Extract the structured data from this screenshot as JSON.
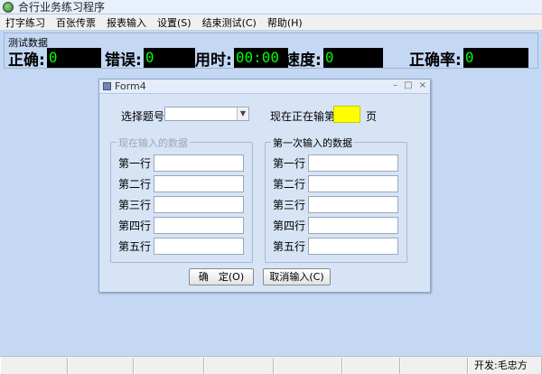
{
  "window": {
    "title": "合行业务练习程序"
  },
  "menu": [
    {
      "label": "打字练习"
    },
    {
      "label": "百张传票"
    },
    {
      "label": "报表输入"
    },
    {
      "label": "设置(S)"
    },
    {
      "label": "结束测试(C)"
    },
    {
      "label": "帮助(H)"
    }
  ],
  "stats": {
    "section_label": "测试数据",
    "correct": {
      "label": "正确:",
      "value": "0"
    },
    "errors": {
      "label": "错误:",
      "value": "0"
    },
    "time": {
      "label": "用时:",
      "value": "00:00"
    },
    "speed": {
      "label": "速度:",
      "value": "0"
    },
    "accuracy": {
      "label": "正确率:",
      "value": "0"
    }
  },
  "form4": {
    "title": "Form4",
    "select_label": "选择题号",
    "select_value": "",
    "current_label": "现在正在输第",
    "current_page": "",
    "page_unit": "页",
    "left_group": {
      "title": "现在输入的数据",
      "rows": [
        {
          "label": "第一行",
          "value": ""
        },
        {
          "label": "第二行",
          "value": ""
        },
        {
          "label": "第三行",
          "value": ""
        },
        {
          "label": "第四行",
          "value": ""
        },
        {
          "label": "第五行",
          "value": ""
        }
      ]
    },
    "right_group": {
      "title": "第一次输入的数据",
      "rows": [
        {
          "label": "第一行",
          "value": ""
        },
        {
          "label": "第二行",
          "value": ""
        },
        {
          "label": "第三行",
          "value": ""
        },
        {
          "label": "第四行",
          "value": ""
        },
        {
          "label": "第五行",
          "value": ""
        }
      ]
    },
    "confirm_button": "确　定(O)",
    "cancel_button": "取消输入(C)"
  },
  "statusbar": {
    "developer": "开发:毛忠方"
  }
}
